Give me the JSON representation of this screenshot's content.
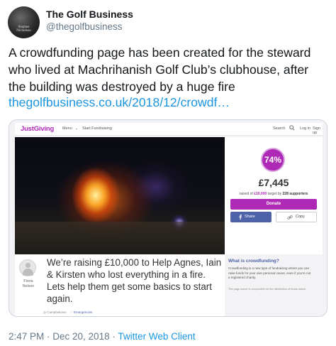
{
  "author": {
    "name": "The Golf Business",
    "handle": "@thegolfbusiness",
    "avatar_text": "Stephen\nNicholson"
  },
  "tweet": {
    "text": "A crowdfunding page has been created for the steward\nwho lived at  Machrihanish Golf Club’s clubhouse, after\nthe building was destroyed by a  huge fire",
    "link": "thegolfbusiness.co.uk/2018/12/crowdf…"
  },
  "justgiving": {
    "logo": "JustGiving",
    "nav": {
      "menu": "Menu",
      "caret": "⌄",
      "start": "Start Fundraising",
      "search": "Search",
      "login": "Log in",
      "signup": "Sign up"
    },
    "percent": "74%",
    "raised": "£7,445",
    "raised_line": {
      "prefix": "raised of ",
      "target": "£10,000",
      "middle": " target by ",
      "supporters": "228 supporters"
    },
    "donate_label": "Donate",
    "share_label": "Share",
    "copy_label": "Copy",
    "fundraiser_name": "Fiona\nNelson",
    "story": "We’re raising £10,000 to Help Agnes, Iain\n& Kirsten who lost everything in a fire.\nLets help them get some basics to start\nagain.",
    "tags": {
      "location": "Campbeltown",
      "category": "Emergencies"
    },
    "info_title": "What is crowdfunding?",
    "info_body": "Crowdfunding is a new type of fundraising where you can\nraise funds for your own personal cause, even if you're not\na registered charity.",
    "info_note": "The page owner is responsible for the distribution of funds raised."
  },
  "footer": {
    "time": "2:47 PM · Dec 20, 2018 · ",
    "client": "Twitter Web Client"
  },
  "colors": {
    "link": "#1b95e0",
    "brand": "#ad29b6",
    "share": "#4d62a8"
  }
}
